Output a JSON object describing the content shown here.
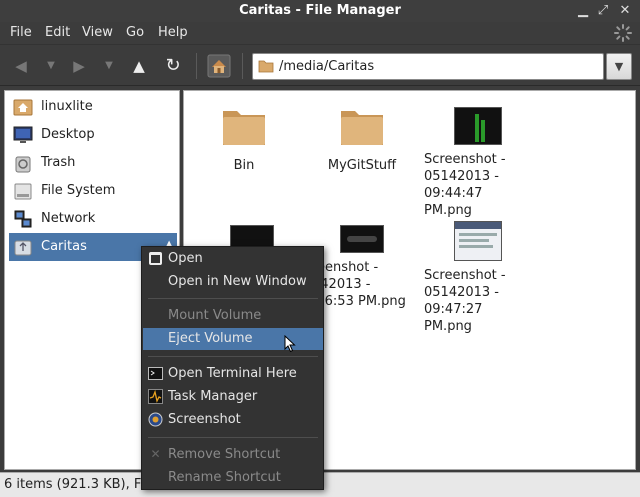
{
  "window": {
    "title": "Caritas - File Manager"
  },
  "menubar": {
    "items": [
      "File",
      "Edit",
      "View",
      "Go",
      "Help"
    ]
  },
  "toolbar": {
    "back": "back-arrow-icon",
    "forward": "forward-arrow-icon",
    "up": "up-arrow-icon",
    "reload": "reload-icon",
    "home": "home-icon",
    "path": "/media/Caritas"
  },
  "sidebar": {
    "items": [
      {
        "label": "linuxlite",
        "icon": "home-folder-icon"
      },
      {
        "label": "Desktop",
        "icon": "desktop-icon"
      },
      {
        "label": "Trash",
        "icon": "trash-icon"
      },
      {
        "label": "File System",
        "icon": "drive-icon"
      },
      {
        "label": "Network",
        "icon": "network-icon"
      },
      {
        "label": "Caritas",
        "icon": "usb-drive-icon",
        "selected": true
      }
    ]
  },
  "files": [
    {
      "name": "Bin",
      "type": "folder"
    },
    {
      "name": "MyGitStuff",
      "type": "folder"
    },
    {
      "name": "Screenshot - 05142013 - 09:44:47 PM.png",
      "type": "image"
    },
    {
      "name": "",
      "type": "image"
    },
    {
      "name": "Screenshot - 05142013 - 09:46:53 PM.png",
      "type": "image",
      "shown": "reenshot -\n142013 -\n:46:53 PM.png"
    },
    {
      "name": "Screenshot - 05142013 - 09:47:27 PM.png",
      "type": "image"
    }
  ],
  "status": {
    "text": "6 items (921.3 KB), Fr"
  },
  "context_menu": {
    "items": [
      {
        "label": "Open",
        "enabled": true,
        "icon": "open-icon"
      },
      {
        "label": "Open in New Window",
        "enabled": true
      },
      {
        "label": "Mount Volume",
        "enabled": false
      },
      {
        "label": "Eject Volume",
        "enabled": true,
        "highlighted": true
      },
      {
        "label": "Open Terminal Here",
        "enabled": true,
        "icon": "terminal-icon"
      },
      {
        "label": "Task Manager",
        "enabled": true,
        "icon": "task-manager-icon"
      },
      {
        "label": "Screenshot",
        "enabled": true,
        "icon": "screenshot-icon"
      },
      {
        "label": "Remove Shortcut",
        "enabled": false,
        "icon": "remove-icon"
      },
      {
        "label": "Rename Shortcut",
        "enabled": false
      }
    ]
  },
  "colors": {
    "selection": "#4a76a8",
    "folder": "#d9a96b",
    "menu_bg": "#333333",
    "chrome": "#3c3c3c"
  }
}
